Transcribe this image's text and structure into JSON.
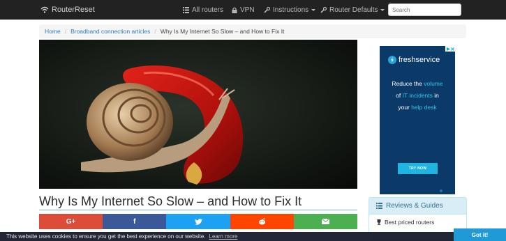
{
  "nav": {
    "brand": "RouterReset",
    "items": [
      {
        "label": "All routers",
        "icon": "list-icon"
      },
      {
        "label": "VPN",
        "icon": "lock-icon"
      },
      {
        "label": "Instructions",
        "icon": "wrench-icon",
        "dropdown": true
      },
      {
        "label": "Router Defaults",
        "icon": "wrench-icon",
        "dropdown": true
      }
    ],
    "search_placeholder": "Search"
  },
  "breadcrumb": {
    "home": "Home",
    "category": "Broadband connection articles",
    "current": "Why Is My Internet So Slow – and How to Fix It"
  },
  "article": {
    "title": "Why Is My Internet So Slow – and How to Fix It"
  },
  "share": [
    {
      "label": "G+",
      "icon": "google-plus-icon",
      "color": "#dd4b39"
    },
    {
      "label": "f",
      "icon": "facebook-icon",
      "color": "#3b5998"
    },
    {
      "label": "",
      "icon": "twitter-icon",
      "color": "#1da1f2"
    },
    {
      "label": "",
      "icon": "reddit-icon",
      "color": "#ff4500"
    },
    {
      "label": "",
      "icon": "email-icon",
      "color": "#4caf50"
    }
  ],
  "ad": {
    "brand": "freshservice",
    "line1_plain": "Reduce the ",
    "line1_hl": "volume",
    "line2_plain_a": "of ",
    "line2_hl": "IT incidents",
    "line2_plain_b": " in",
    "line3_plain": "your ",
    "line3_hl": "help desk",
    "cta": "TRY NOW"
  },
  "sidebar": {
    "panel_title": "Reviews & Guides",
    "items": [
      {
        "label": "Best priced routers",
        "icon": "trophy-icon"
      }
    ]
  },
  "cookie": {
    "text": "This website uses cookies to ensure you get the best experience on our website.",
    "learn_more": "Learn more",
    "button": "Got it!"
  }
}
